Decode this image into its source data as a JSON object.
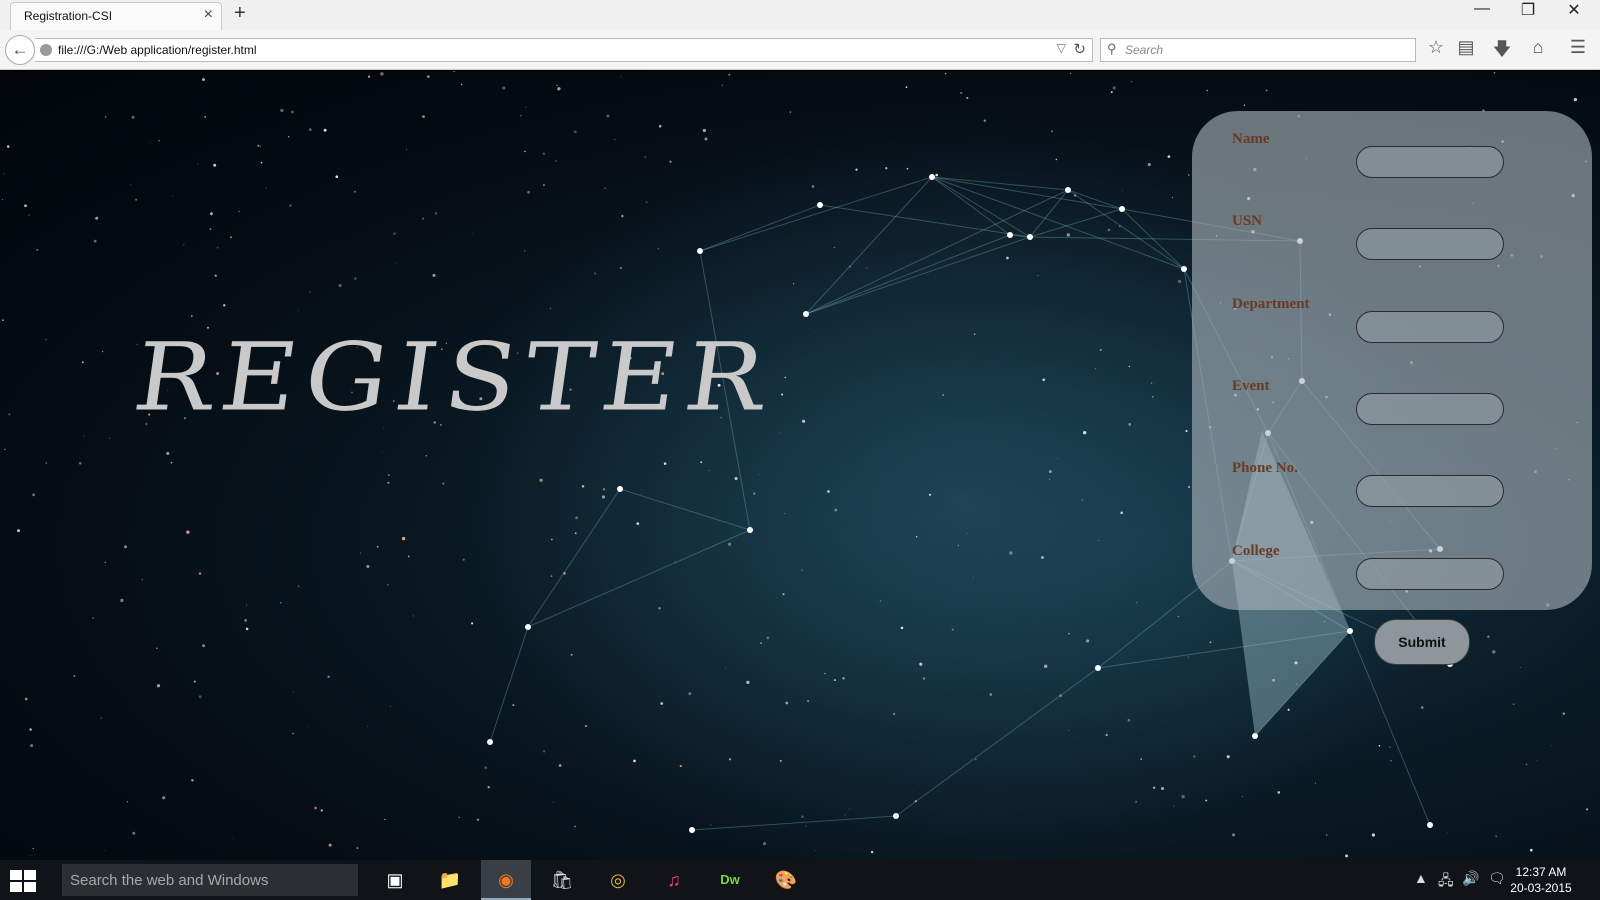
{
  "browser": {
    "tab_title": "Registration-CSI",
    "tab_close": "×",
    "new_tab": "+",
    "window_controls": {
      "minimize": "—",
      "restore": "❐",
      "close": "✕"
    },
    "url": "file:///G:/Web application/register.html",
    "search_placeholder": "Search",
    "toolbar_icons": [
      "star-icon",
      "reading-list-icon",
      "download-icon",
      "home-icon",
      "menu-icon"
    ]
  },
  "page": {
    "title": "REGISTER",
    "form": {
      "fields": [
        {
          "label": "Name"
        },
        {
          "label": "USN"
        },
        {
          "label": "Department"
        },
        {
          "label": "Event"
        },
        {
          "label": "Phone No."
        },
        {
          "label": "College"
        }
      ],
      "submit_label": "Submit"
    }
  },
  "taskbar": {
    "search_placeholder": "Search the web and Windows",
    "apps": [
      "task-view",
      "file-explorer",
      "firefox",
      "store",
      "chrome",
      "itunes",
      "dreamweaver",
      "paint"
    ],
    "active_app": "firefox",
    "time": "12:37 AM",
    "date": "20-03-2015"
  },
  "colors": {
    "label": "#6b3a22",
    "panel": "#aab4bc",
    "title": "#c9c9c9",
    "background": "#050c13"
  }
}
